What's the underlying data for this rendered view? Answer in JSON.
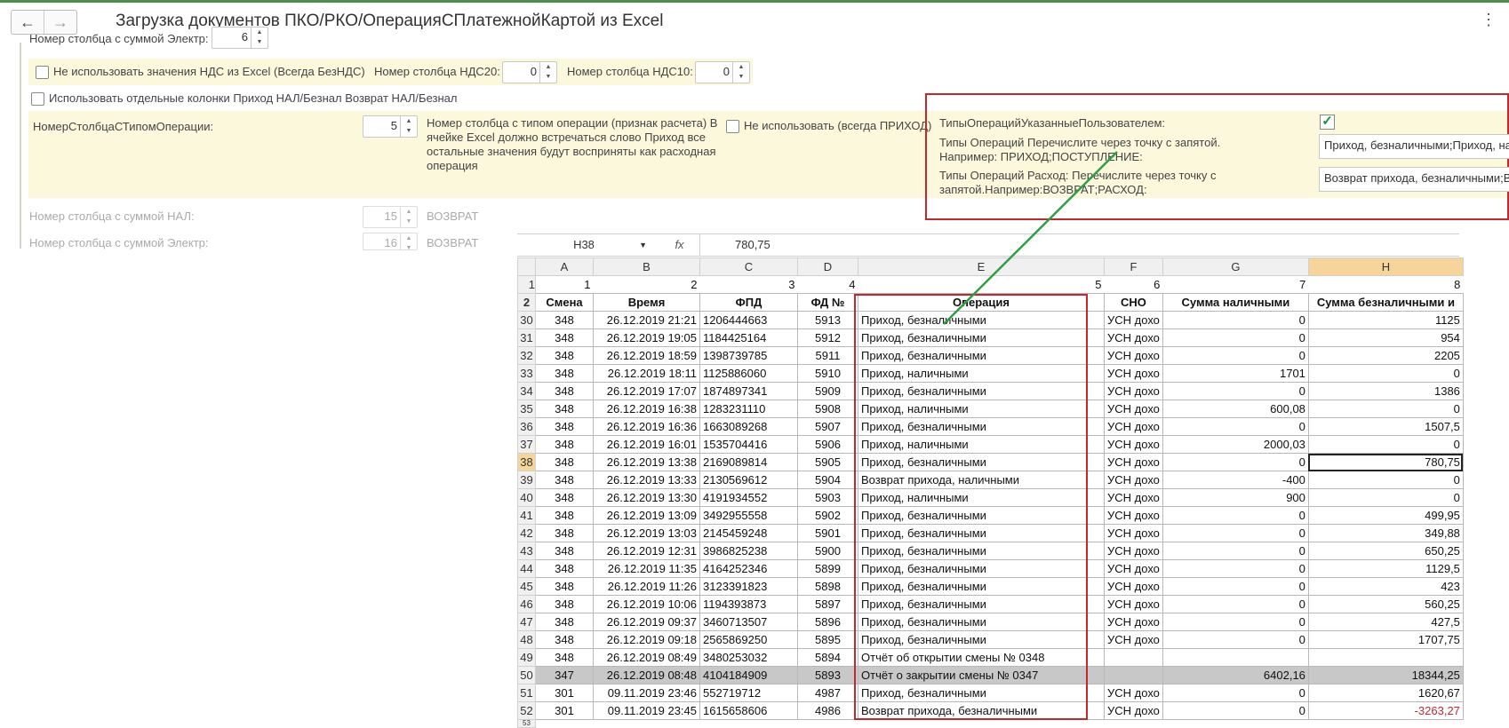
{
  "window": {
    "title": "Загрузка документов ПКО/РКО/ОперацияСПлатежнойКартой  из Excel"
  },
  "form": {
    "cut_label": "Номер столбца с суммой Электр:",
    "cut_value": "6",
    "no_nds_label": "Не использовать значения НДС из Excel (Всегда БезНДС)",
    "nds20_label": "Номер столбца НДС20:",
    "nds20_value": "0",
    "nds10_label": "Номер столбца НДС10:",
    "nds10_value": "0",
    "separate_cols_label": "Использовать отдельные колонки Приход НАЛ/Безнал Возврат НАЛ/Безнал",
    "optype_col_label": "НомерСтолбцаСТипомОперации:",
    "optype_col_value": "5",
    "optype_hint": "Номер столбца с типом операции (признак расчета) В ячейке Excel должно встречаться слово Приход все остальные значения будут восприняты как расходная операция",
    "dont_use_label": "Не использовать (всегда ПРИХОД)",
    "user_types_label": "ТипыОперацийУказанныеПользователем:",
    "user_types_checked": true,
    "income_types_label": "Типы Операций Перечислите через точку с запятой. Например: ПРИХОД;ПОСТУПЛЕНИЕ:",
    "income_types_value": "Приход, безналичными;Приход, на",
    "expense_types_label": "Типы Операций Расход: Перечислите через точку с запятой.Например:ВОЗВРАТ;РАСХОД:",
    "expense_types_value": "Возврат прихода, безналичными;В",
    "cash_col_label": "Номер столбца с суммой НАЛ:",
    "cash_col_value": "15",
    "cash_col_suffix": "ВОЗВРАТ",
    "el_col_label": "Номер столбца с суммой Электр:",
    "el_col_value": "16",
    "el_col_suffix": "ВОЗВРАТ"
  },
  "excel": {
    "name_box": "H38",
    "fx": "fx",
    "formula": "780,75",
    "columns": [
      "A",
      "B",
      "C",
      "D",
      "E",
      "F",
      "G",
      "H"
    ],
    "number_row": {
      "row": "1",
      "values": [
        "1",
        "2",
        "3",
        "4",
        "5",
        "6",
        "7",
        "8"
      ]
    },
    "header_row": {
      "row": "2",
      "values": [
        "Смена",
        "Время",
        "ФПД",
        "ФД №",
        "Операция",
        "СНО",
        "Сумма наличными",
        "Сумма безналичными"
      ],
      "extra": "и"
    },
    "rows": [
      {
        "row": "30",
        "values": [
          "348",
          "26.12.2019 21:21",
          "1206444663",
          "5913",
          "Приход, безналичными",
          "УСН дохо",
          "0",
          "1125"
        ]
      },
      {
        "row": "31",
        "values": [
          "348",
          "26.12.2019 19:05",
          "1184425164",
          "5912",
          "Приход, безналичными",
          "УСН дохо",
          "0",
          "954"
        ]
      },
      {
        "row": "32",
        "values": [
          "348",
          "26.12.2019 18:59",
          "1398739785",
          "5911",
          "Приход, безналичными",
          "УСН дохо",
          "0",
          "2205"
        ]
      },
      {
        "row": "33",
        "values": [
          "348",
          "26.12.2019 18:11",
          "1125886060",
          "5910",
          "Приход, наличными",
          "УСН дохо",
          "1701",
          "0"
        ]
      },
      {
        "row": "34",
        "values": [
          "348",
          "26.12.2019 17:07",
          "1874897341",
          "5909",
          "Приход, безналичными",
          "УСН дохо",
          "0",
          "1386"
        ]
      },
      {
        "row": "35",
        "values": [
          "348",
          "26.12.2019 16:38",
          "1283231110",
          "5908",
          "Приход, наличными",
          "УСН дохо",
          "600,08",
          "0"
        ]
      },
      {
        "row": "36",
        "values": [
          "348",
          "26.12.2019 16:36",
          "1663089268",
          "5907",
          "Приход, безналичными",
          "УСН дохо",
          "0",
          "1507,5"
        ]
      },
      {
        "row": "37",
        "values": [
          "348",
          "26.12.2019 16:01",
          "1535704416",
          "5906",
          "Приход, наличными",
          "УСН дохо",
          "2000,03",
          "0"
        ]
      },
      {
        "row": "38",
        "values": [
          "348",
          "26.12.2019 13:38",
          "2169089814",
          "5905",
          "Приход, безналичными",
          "УСН дохо",
          "0",
          "780,75"
        ]
      },
      {
        "row": "39",
        "values": [
          "348",
          "26.12.2019 13:33",
          "2130569612",
          "5904",
          "Возврат прихода, наличными",
          "УСН дохо",
          "-400",
          "0"
        ]
      },
      {
        "row": "40",
        "values": [
          "348",
          "26.12.2019 13:30",
          "4191934552",
          "5903",
          "Приход, наличными",
          "УСН дохо",
          "900",
          "0"
        ]
      },
      {
        "row": "41",
        "values": [
          "348",
          "26.12.2019 13:09",
          "3492955558",
          "5902",
          "Приход, безналичными",
          "УСН дохо",
          "0",
          "499,95"
        ]
      },
      {
        "row": "42",
        "values": [
          "348",
          "26.12.2019 13:03",
          "2145459248",
          "5901",
          "Приход, безналичными",
          "УСН дохо",
          "0",
          "349,88"
        ]
      },
      {
        "row": "43",
        "values": [
          "348",
          "26.12.2019 12:31",
          "3986825238",
          "5900",
          "Приход, безналичными",
          "УСН дохо",
          "0",
          "650,25"
        ]
      },
      {
        "row": "44",
        "values": [
          "348",
          "26.12.2019 11:35",
          "4164252346",
          "5899",
          "Приход, безналичными",
          "УСН дохо",
          "0",
          "1129,5"
        ]
      },
      {
        "row": "45",
        "values": [
          "348",
          "26.12.2019 11:26",
          "3123391823",
          "5898",
          "Приход, безналичными",
          "УСН дохо",
          "0",
          "423"
        ]
      },
      {
        "row": "46",
        "values": [
          "348",
          "26.12.2019 10:06",
          "1194393873",
          "5897",
          "Приход, безналичными",
          "УСН дохо",
          "0",
          "560,25"
        ]
      },
      {
        "row": "47",
        "values": [
          "348",
          "26.12.2019 09:37",
          "3460713507",
          "5896",
          "Приход, безналичными",
          "УСН дохо",
          "0",
          "427,5"
        ]
      },
      {
        "row": "48",
        "values": [
          "348",
          "26.12.2019 09:18",
          "2565869250",
          "5895",
          "Приход, безналичными",
          "УСН дохо",
          "0",
          "1707,75"
        ]
      },
      {
        "row": "49",
        "values": [
          "348",
          "26.12.2019 08:49",
          "3480253032",
          "5894",
          "Отчёт об открытии смены № 0348",
          "",
          "",
          ""
        ]
      },
      {
        "row": "50",
        "values": [
          "347",
          "26.12.2019 08:48",
          "4104184909",
          "5893",
          "Отчёт о закрытии смены № 0347",
          "",
          "6402,16",
          "18344,25"
        ]
      },
      {
        "row": "51",
        "values": [
          "301",
          "09.11.2019 23:46",
          "552719712",
          "4987",
          "Приход, безналичными",
          "УСН дохо",
          "0",
          "1620,67"
        ]
      },
      {
        "row": "52",
        "values": [
          "301",
          "09.11.2019 23:45",
          "1615658606",
          "4986",
          "Возврат прихода, безналичными",
          "УСН дохо",
          "0",
          "-3263,27"
        ]
      }
    ],
    "partial_row": "53",
    "active_row": "38",
    "active_col": "H",
    "highlight_row": "50"
  }
}
